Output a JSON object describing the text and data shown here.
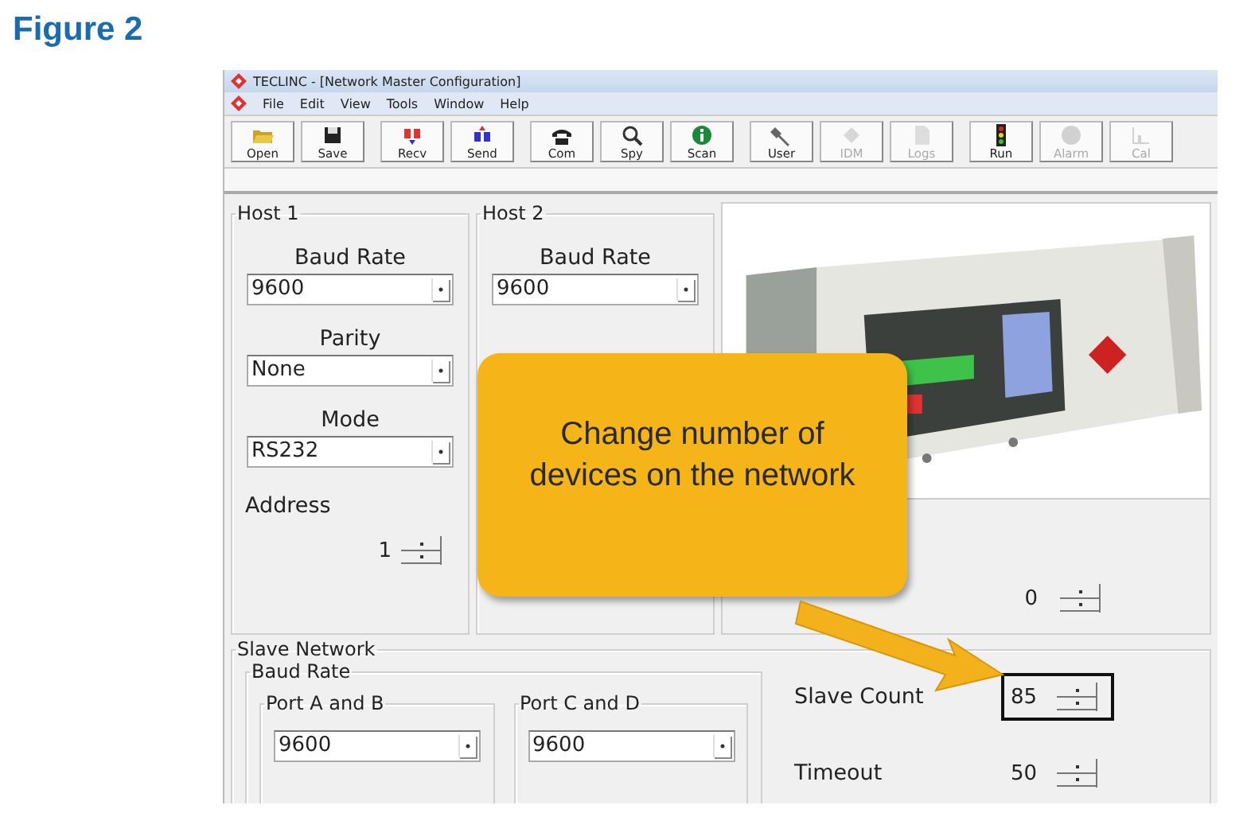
{
  "figure_label": "Figure 2",
  "window": {
    "title": "TECLINC - [Network Master Configuration]"
  },
  "menu": [
    "File",
    "Edit",
    "View",
    "Tools",
    "Window",
    "Help"
  ],
  "toolbar": [
    [
      {
        "label": "Open",
        "kind": "folder",
        "disabled": false
      },
      {
        "label": "Save",
        "kind": "disk",
        "disabled": false
      }
    ],
    [
      {
        "label": "Recv",
        "kind": "receive",
        "disabled": false
      },
      {
        "label": "Send",
        "kind": "send",
        "disabled": false
      }
    ],
    [
      {
        "label": "Com",
        "kind": "phone",
        "disabled": false
      },
      {
        "label": "Spy",
        "kind": "magnifier",
        "disabled": false
      },
      {
        "label": "Scan",
        "kind": "info",
        "disabled": false
      }
    ],
    [
      {
        "label": "User",
        "kind": "wrench",
        "disabled": false
      },
      {
        "label": "IDM",
        "kind": "diamond",
        "disabled": true
      },
      {
        "label": "Logs",
        "kind": "document",
        "disabled": true
      }
    ],
    [
      {
        "label": "Run",
        "kind": "traffic",
        "disabled": false
      },
      {
        "label": "Alarm",
        "kind": "circle",
        "disabled": true
      },
      {
        "label": "Cal",
        "kind": "chart",
        "disabled": true
      }
    ]
  ],
  "hosts": [
    {
      "title": "Host 1",
      "baud_label": "Baud Rate",
      "baud_rate": "9600",
      "parity_label": "Parity",
      "parity": "None",
      "mode_label": "Mode",
      "mode": "RS232",
      "address_label": "Address",
      "address": "1"
    },
    {
      "title": "Host 2",
      "baud_label": "Baud Rate",
      "baud_rate": "9600"
    }
  ],
  "device_panel": {
    "value": "0"
  },
  "slave_network": {
    "title": "Slave Network",
    "baud_group": "Baud Rate",
    "ports": [
      {
        "title": "Port A and B",
        "value": "9600"
      },
      {
        "title": "Port C and D",
        "value": "9600"
      }
    ],
    "slave_count": {
      "label": "Slave Count",
      "value": "85",
      "highlighted": true
    },
    "timeout": {
      "label": "Timeout",
      "value": "50",
      "highlighted": false
    }
  },
  "callout": {
    "text": "Change number of devices on the network"
  }
}
